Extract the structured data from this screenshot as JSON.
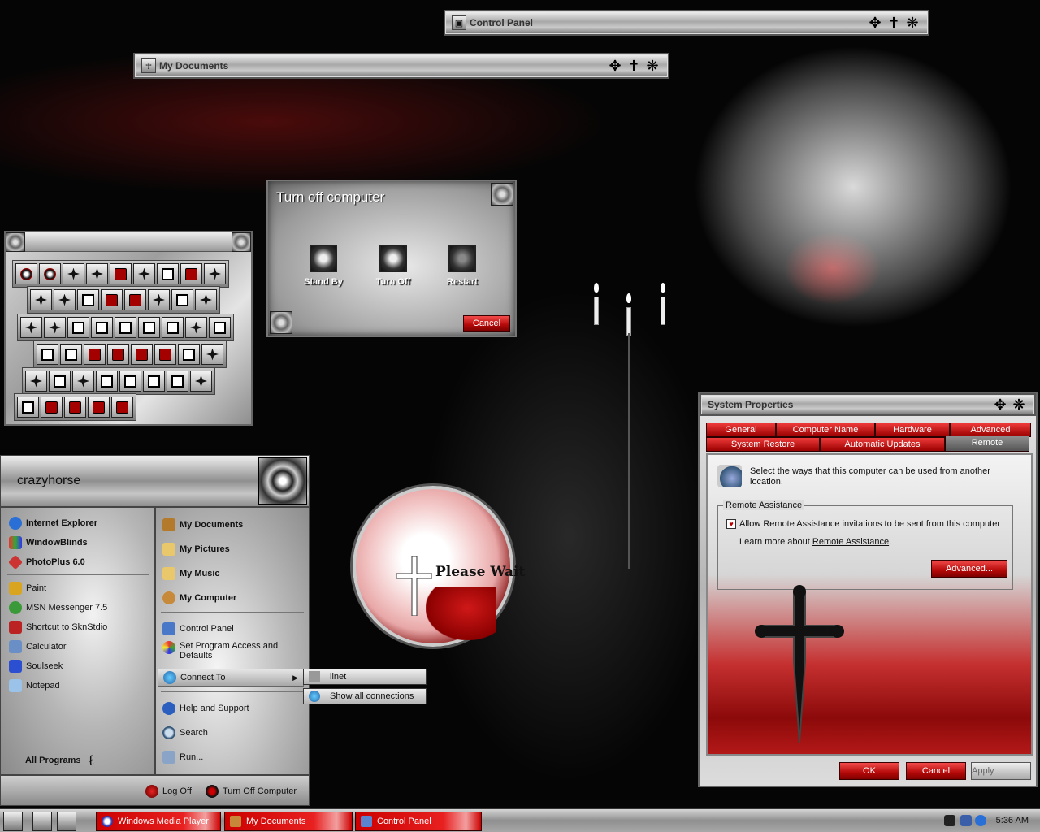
{
  "windows": {
    "control_panel": {
      "title": "Control Panel"
    },
    "my_documents": {
      "title": "My Documents"
    }
  },
  "turn_off": {
    "title": "Turn off computer",
    "options": [
      "Stand By",
      "Turn Off",
      "Restart"
    ],
    "cancel": "Cancel"
  },
  "start_menu": {
    "user": "crazyhorse",
    "pinned": [
      "Internet Explorer",
      "WindowBlinds",
      "PhotoPlus 6.0"
    ],
    "recent": [
      "Paint",
      "MSN Messenger 7.5",
      "Shortcut to SknStdio",
      "Calculator",
      "Soulseek",
      "Notepad"
    ],
    "all_programs": "All Programs",
    "places": [
      "My Documents",
      "My Pictures",
      "My Music",
      "My Computer"
    ],
    "system": [
      "Control Panel",
      "Set Program Access and Defaults",
      "Connect To"
    ],
    "help": [
      "Help and Support",
      "Search",
      "Run..."
    ],
    "log_off": "Log Off",
    "turn_off": "Turn Off Computer"
  },
  "connect_submenu": [
    "iinet",
    "Show all connections"
  ],
  "please_wait": {
    "text": "Please Wait"
  },
  "system_properties": {
    "title": "System Properties",
    "tabs_row1": [
      "General",
      "Computer Name",
      "Hardware",
      "Advanced"
    ],
    "tabs_row2": [
      "System Restore",
      "Automatic Updates",
      "Remote"
    ],
    "active_tab": "Remote",
    "description": "Select the ways that this computer can be used from another location.",
    "group_label": "Remote Assistance",
    "checkbox_label": "Allow Remote Assistance invitations to be sent from this computer",
    "checkbox_checked": true,
    "learn_prefix": "Learn more about",
    "learn_link": "Remote Assistance",
    "learn_suffix": ".",
    "advanced_button": "Advanced...",
    "ok": "OK",
    "cancel": "Cancel",
    "apply": "Apply"
  },
  "taskbar": {
    "tasks": [
      "Windows Media Player",
      "My Documents",
      "Control Panel"
    ],
    "clock": "5:36 AM"
  },
  "colors": {
    "accent_red": "#c40000",
    "metal": "#b0b0b0"
  }
}
